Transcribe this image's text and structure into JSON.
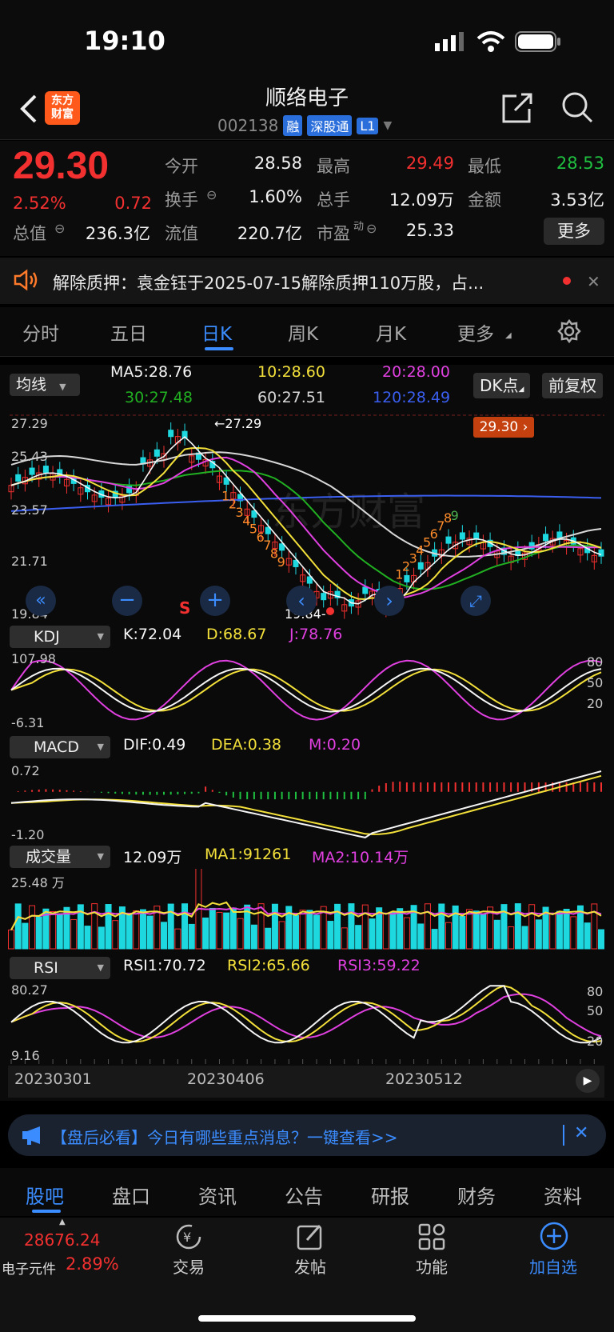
{
  "status": {
    "time": "19:10"
  },
  "header": {
    "title": "顺络电子",
    "code": "002138",
    "tags": [
      "融",
      "深股通",
      "L1"
    ],
    "logo_line1": "东方",
    "logo_line2": "财富"
  },
  "quote": {
    "price": "29.30",
    "change_pct": "2.52%",
    "change": "0.72",
    "open_label": "今开",
    "open": "28.58",
    "high_label": "最高",
    "high": "29.49",
    "low_label": "最低",
    "low": "28.53",
    "turnover_label": "换手",
    "turnover": "1.60%",
    "volume_label": "总手",
    "volume": "12.09万",
    "amount_label": "金额",
    "amount": "3.53亿",
    "mktcap_label": "总值",
    "mktcap": "236.3亿",
    "float_label": "流值",
    "float": "220.7亿",
    "pe_label": "市盈",
    "pe_sup": "动",
    "pe": "25.33",
    "more": "更多"
  },
  "notice": {
    "text": "解除质押：袁金钰于2025-07-15解除质押110万股，占..."
  },
  "tabs": [
    "分时",
    "五日",
    "日K",
    "周K",
    "月K",
    "更多"
  ],
  "active_tab": "日K",
  "kline": {
    "selector": "均线",
    "ma5": "MA5:28.76",
    "ma10": "10:28.60",
    "ma20": "20:28.00",
    "ma30": "30:27.48",
    "ma60": "60:27.51",
    "ma120": "120:28.49",
    "dk_btn": "DK点",
    "adjust_btn": "前复权",
    "y_top": "27.29",
    "y_2": "25.43",
    "y_3": "23.57",
    "y_4": "21.71",
    "y_bottom": "19.84",
    "max_marker": "27.29",
    "min_marker": "19.84",
    "current_tag": "29.30",
    "s_mark": "S",
    "watermark": "东方财富",
    "dk_sell_seq": [
      "1",
      "2",
      "3",
      "4",
      "5",
      "6",
      "7",
      "8",
      "9"
    ],
    "dk_buy_seq": [
      "1",
      "2",
      "3",
      "4",
      "5",
      "6",
      "7",
      "8",
      "9"
    ],
    "colors": {
      "ma5": "#f5f5f5",
      "ma10": "#f3e03a",
      "ma20": "#e040e0",
      "ma30": "#21b021",
      "ma60": "#d8d8d8",
      "ma120": "#3a5ff0",
      "up": "#f23030",
      "down": "#1ed8e0"
    }
  },
  "kdj": {
    "selector": "KDJ",
    "k": "K:72.04",
    "d": "D:68.67",
    "j": "J:78.76",
    "y_top": "107.98",
    "y_bottom": "-6.31",
    "r80": "80",
    "r50": "50",
    "r20": "20"
  },
  "macd": {
    "selector": "MACD",
    "dif": "DIF:0.49",
    "dea": "DEA:0.38",
    "m": "M:0.20",
    "y_top": "0.72",
    "y_bottom": "-1.20"
  },
  "vol": {
    "selector": "成交量",
    "v": "12.09万",
    "ma1": "MA1:91261",
    "ma2": "MA2:10.14万",
    "y_top": "25.48 万"
  },
  "rsi": {
    "selector": "RSI",
    "rsi1": "RSI1:70.72",
    "rsi2": "RSI2:65.66",
    "rsi3": "RSI3:59.22",
    "y_top": "80.27",
    "y_bottom": "9.16",
    "r80": "80",
    "r50": "50",
    "r20": "20"
  },
  "dates": [
    "20230301",
    "20230406",
    "20230512"
  ],
  "banner": {
    "text": "【盘后必看】今日有哪些重点消息？一键查看>>"
  },
  "bottom_tabs": [
    "股吧",
    "盘口",
    "资讯",
    "公告",
    "研报",
    "财务",
    "资料"
  ],
  "dock": {
    "index_value": "28676.24",
    "index_name": "电子元件",
    "index_pct": "2.89%",
    "items": [
      "交易",
      "发帖",
      "功能",
      "加自选"
    ]
  }
}
